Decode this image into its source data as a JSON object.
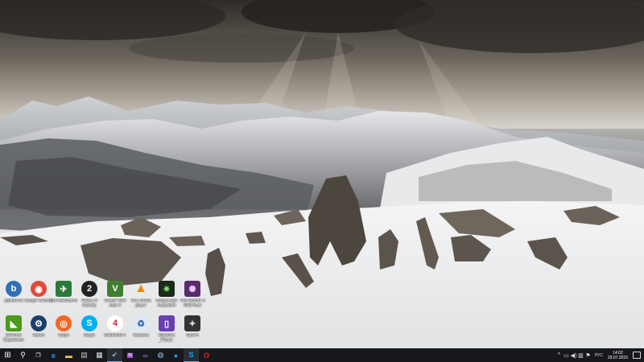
{
  "desktop": {
    "icons_row1": [
      {
        "label": "qBittorrent",
        "icon": "qbittorrent-icon",
        "color": "#2f6fb7",
        "glyph": "b"
      },
      {
        "label": "Google Chrome",
        "icon": "chrome-icon",
        "color": "#dd4b39",
        "glyph": "◉"
      },
      {
        "label": "MSI Afterburner",
        "icon": "msi-afterburner-icon",
        "color": "#2c7a3a",
        "glyph": "✈"
      },
      {
        "label": "Pillars of Eternity",
        "icon": "pillars-icon",
        "color": "#222222",
        "glyph": "2"
      },
      {
        "label": "Grand Theft Auto V",
        "icon": "gta-v-icon",
        "color": "#3f7f2f",
        "glyph": "V"
      },
      {
        "label": "VLC media player",
        "icon": "vlc-icon",
        "color": "#f08a00",
        "glyph": "▲"
      },
      {
        "label": "Dragon Age Inquisition",
        "icon": "dragon-age-icon",
        "color": "#1b2a1b",
        "glyph": "✷"
      },
      {
        "label": "The Witcher 3 Wild Hunt",
        "icon": "witcher-icon",
        "color": "#5a2a6a",
        "glyph": "✺"
      }
    ],
    "icons_row2": [
      {
        "label": "GeForce Experience",
        "icon": "geforce-icon",
        "color": "#4c9a1a",
        "glyph": "◣"
      },
      {
        "label": "Steam",
        "icon": "steam-icon",
        "color": "#1b3f6a",
        "glyph": "⚙"
      },
      {
        "label": "Origin",
        "icon": "origin-icon",
        "color": "#f26722",
        "glyph": "◎"
      },
      {
        "label": "Skype",
        "icon": "skype-icon",
        "color": "#00aff0",
        "glyph": "S"
      },
      {
        "label": "Battlefield 4",
        "icon": "battlefield-icon",
        "color": "#c62828",
        "glyph": "4"
      },
      {
        "label": "Корзина",
        "icon": "recycle-bin-icon",
        "color": "#8aa8c8",
        "glyph": "♻"
      },
      {
        "label": "Windows Phone Recovery",
        "icon": "windows-phone-icon",
        "color": "#6b3fb0",
        "glyph": "▯"
      },
      {
        "label": "Skyrim",
        "icon": "skyrim-icon",
        "color": "#333333",
        "glyph": "✦"
      }
    ]
  },
  "taskbar": {
    "apps": [
      {
        "name": "start-button",
        "icon": "windows-logo-icon",
        "glyph": "⊞",
        "color": "#ffffff",
        "active": false
      },
      {
        "name": "search-button",
        "icon": "search-icon",
        "glyph": "⚲",
        "color": "#ffffff",
        "active": false
      },
      {
        "name": "task-view-button",
        "icon": "task-view-icon",
        "glyph": "❐",
        "color": "#ffffff",
        "active": false
      },
      {
        "name": "taskbar-edge",
        "icon": "edge-icon",
        "glyph": "e",
        "color": "#3a8fe0",
        "active": false
      },
      {
        "name": "taskbar-explorer",
        "icon": "folder-icon",
        "glyph": "▬",
        "color": "#f2c14e",
        "active": false
      },
      {
        "name": "taskbar-store",
        "icon": "store-icon",
        "glyph": "▤",
        "color": "#cccccc",
        "active": false
      },
      {
        "name": "taskbar-calculator",
        "icon": "calculator-icon",
        "glyph": "▦",
        "color": "#dddddd",
        "active": false
      },
      {
        "name": "taskbar-app-check",
        "icon": "checkmark-icon",
        "glyph": "✔",
        "color": "#8fb8e8",
        "active": true
      },
      {
        "name": "taskbar-onenote",
        "icon": "onenote-icon",
        "glyph": "N",
        "color": "#a44fcf",
        "active": false
      },
      {
        "name": "taskbar-visual-studio",
        "icon": "visual-studio-icon",
        "glyph": "∞",
        "color": "#9b73d8",
        "active": false
      },
      {
        "name": "taskbar-app-globe",
        "icon": "globe-icon",
        "glyph": "◍",
        "color": "#9fc2e8",
        "active": false
      },
      {
        "name": "taskbar-app-blue",
        "icon": "blue-circle-icon",
        "glyph": "●",
        "color": "#3a8fe0",
        "active": false
      },
      {
        "name": "taskbar-skype",
        "icon": "skype-icon",
        "glyph": "S",
        "color": "#00aff0",
        "active": true
      },
      {
        "name": "taskbar-opera",
        "icon": "opera-icon",
        "glyph": "O",
        "color": "#e0262a",
        "active": false
      }
    ],
    "tray": {
      "language": "РУС",
      "time": "14:02",
      "date": "29.07.2015"
    }
  }
}
